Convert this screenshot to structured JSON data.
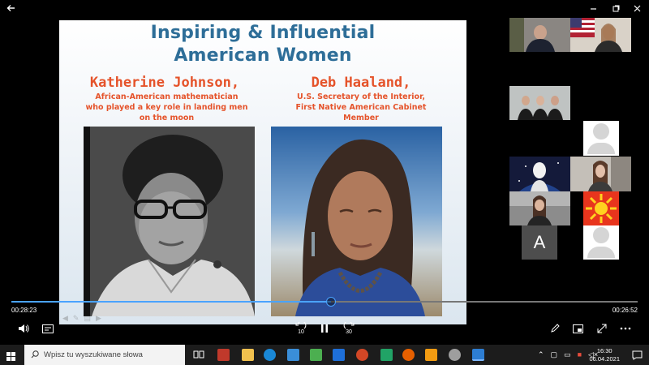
{
  "player": {
    "elapsed": "00:28:23",
    "duration": "00:26:52",
    "progress_fraction": 0.51,
    "rewind_label": "10",
    "forward_label": "30"
  },
  "slide": {
    "title_line1": "Inspiring & Influential",
    "title_line2": "American Women",
    "left": {
      "name": "Katherine Johnson,",
      "desc1": "African-American mathematician",
      "desc2": "who played a key role in landing men",
      "desc3": "on the moon"
    },
    "right": {
      "name": "Deb Haaland,",
      "desc1": "U.S. Secretary of the Interior,",
      "desc2": "First Native American Cabinet",
      "desc3": "Member"
    }
  },
  "participants": {
    "letter_avatar": "A"
  },
  "taskbar": {
    "search_placeholder": "Wpisz tu wyszukiwane słowa",
    "time": "16:30",
    "date": "06.04.2021"
  },
  "colors": {
    "title": "#2e6e98",
    "accent_text": "#e5532a",
    "progress": "#4aa3ff"
  }
}
